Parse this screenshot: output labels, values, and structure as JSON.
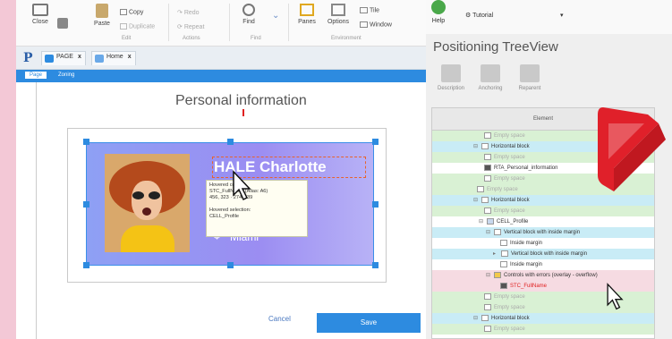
{
  "ribbon": {
    "close_label": "Close",
    "paste_label": "Paste",
    "copy_label": "Copy",
    "duplicate_label": "Duplicate",
    "redo_label": "Redo",
    "repeat_label": "Repeat",
    "find_label": "Find",
    "panes_label": "Panes",
    "options_label": "Options",
    "tile_label": "Tile",
    "window_label": "Window",
    "group_edit": "Edit",
    "group_actions": "Actions",
    "group_find": "Find",
    "group_environment": "Environment"
  },
  "doc_tabs": [
    {
      "label": "PAGE",
      "close": "x"
    },
    {
      "label": "Home",
      "close": "x"
    }
  ],
  "page_tabs": [
    "Page",
    "Zoning"
  ],
  "page": {
    "title": "Personal information",
    "profile": {
      "name": "HALE Charlotte",
      "age": "25",
      "city": "Miami"
    },
    "tooltip": {
      "line1": "Hovered control:",
      "line2": "STC_FullName (Alias: A6)",
      "line3": "456, 323 · 274 x 39",
      "line4": "Hovered selection:",
      "line5": "CELL_Profile"
    },
    "cancel_label": "Cancel",
    "save_label": "Save"
  },
  "right_panel": {
    "help_label": "Help",
    "tutorial_label": "Tutorial",
    "title": "Positioning TreeView",
    "tools": [
      "Description",
      "Anchoring",
      "Reparent"
    ],
    "tree_header": "Element",
    "rows": [
      {
        "label": "Empty space",
        "indent": 3
      },
      {
        "label": "Horizontal block",
        "indent": 1
      },
      {
        "label": "Empty space",
        "indent": 3
      },
      {
        "label": "RTA_Personal_information",
        "indent": 3
      },
      {
        "label": "Empty space",
        "indent": 3
      },
      {
        "label": "Empty space",
        "indent": 2
      },
      {
        "label": "Horizontal block",
        "indent": 1
      },
      {
        "label": "Empty space",
        "indent": 3
      },
      {
        "label": "CELL_Profile",
        "indent": 2
      },
      {
        "label": "Vertical block with inside margin",
        "indent": 3
      },
      {
        "label": "Inside margin",
        "indent": 4
      },
      {
        "label": "Vertical block with inside margin",
        "indent": 4
      },
      {
        "label": "Inside margin",
        "indent": 4
      },
      {
        "label": "Controls with errors (overlay - overflow)",
        "indent": 3
      },
      {
        "label": "STC_FullName",
        "indent": 4
      },
      {
        "label": "Empty space",
        "indent": 3
      },
      {
        "label": "Empty space",
        "indent": 3
      },
      {
        "label": "Horizontal block",
        "indent": 1
      },
      {
        "label": "Empty space",
        "indent": 3
      }
    ]
  },
  "colors": {
    "accent_blue": "#2d8be0",
    "error_red": "#e02020",
    "profile_gradient": "#9b8df2"
  }
}
